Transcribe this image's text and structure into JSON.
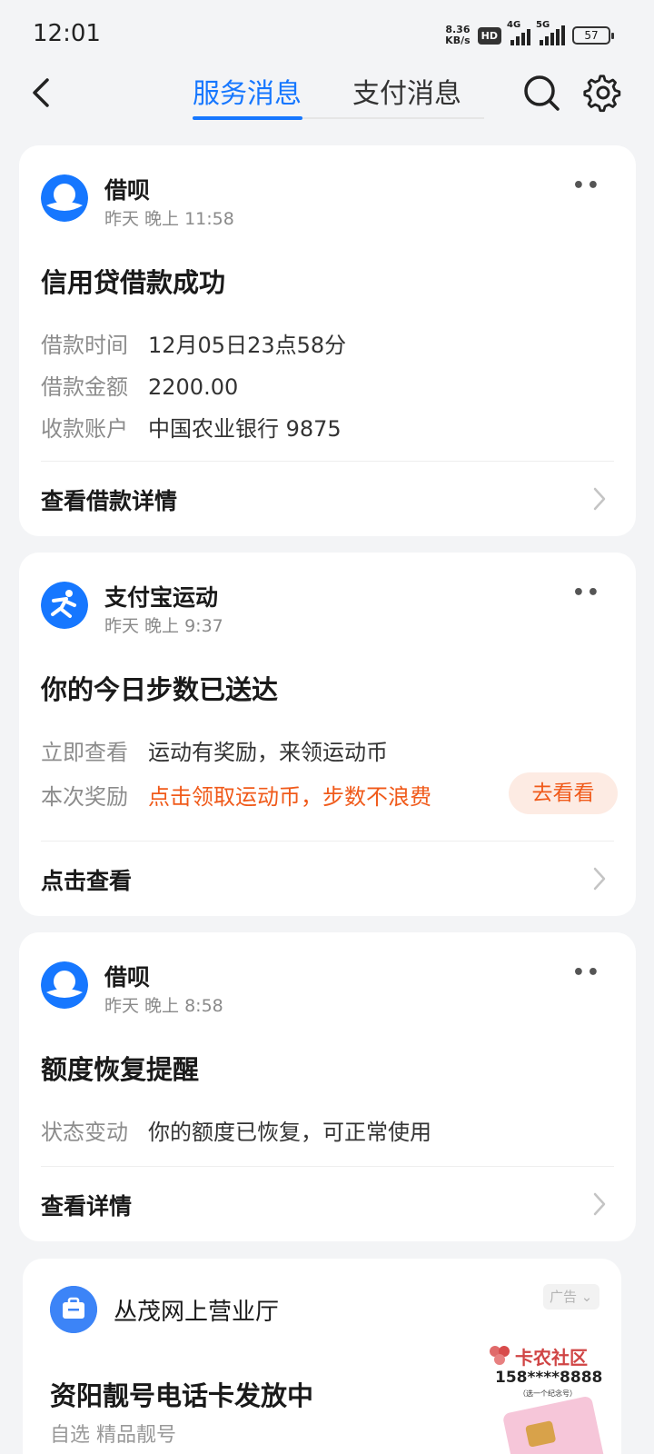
{
  "status_bar": {
    "time": "12:01",
    "net_speed_value": "8.36",
    "net_speed_unit": "KB/s",
    "hd_label": "HD",
    "signal1_label": "4G",
    "signal2_label": "5G",
    "battery": "57"
  },
  "header": {
    "tabs": [
      {
        "label": "服务消息",
        "active": true
      },
      {
        "label": "支付消息",
        "active": false
      }
    ],
    "icons": [
      "back-icon",
      "search-icon",
      "gear-icon"
    ]
  },
  "messages": [
    {
      "sender": "借呗",
      "time": "昨天 晚上 11:58",
      "title": "信用贷借款成功",
      "rows": [
        {
          "key": "借款时间",
          "value": "12月05日23点58分"
        },
        {
          "key": "借款金额",
          "value": "2200.00"
        },
        {
          "key": "收款账户",
          "value": "中国农业银行 9875"
        }
      ],
      "footer": "查看借款详情"
    },
    {
      "sender": "支付宝运动",
      "time": "昨天 晚上 9:37",
      "title": "你的今日步数已送达",
      "rows": [
        {
          "key": "立即查看",
          "value": "运动有奖励，来领运动币"
        },
        {
          "key": "本次奖励",
          "value": "点击领取运动币，步数不浪费"
        }
      ],
      "action_button": "去看看",
      "footer": "点击查看"
    },
    {
      "sender": "借呗",
      "time": "昨天 晚上 8:58",
      "title": "额度恢复提醒",
      "rows": [
        {
          "key": "状态变动",
          "value": "你的额度已恢复，可正常使用"
        }
      ],
      "footer": "查看详情"
    }
  ],
  "ad": {
    "name": "丛茂网上营业厅",
    "tag": "广告",
    "title": "资阳靓号电话卡发放中",
    "subtitle": "自选 精品靓号"
  },
  "watermark": {
    "brand": "卡农社区",
    "number": "158****8888",
    "note": "（选一个纪念号）"
  },
  "colors": {
    "accent": "#1677ff",
    "orange": "#f05a1a",
    "background": "#f3f4f6"
  }
}
